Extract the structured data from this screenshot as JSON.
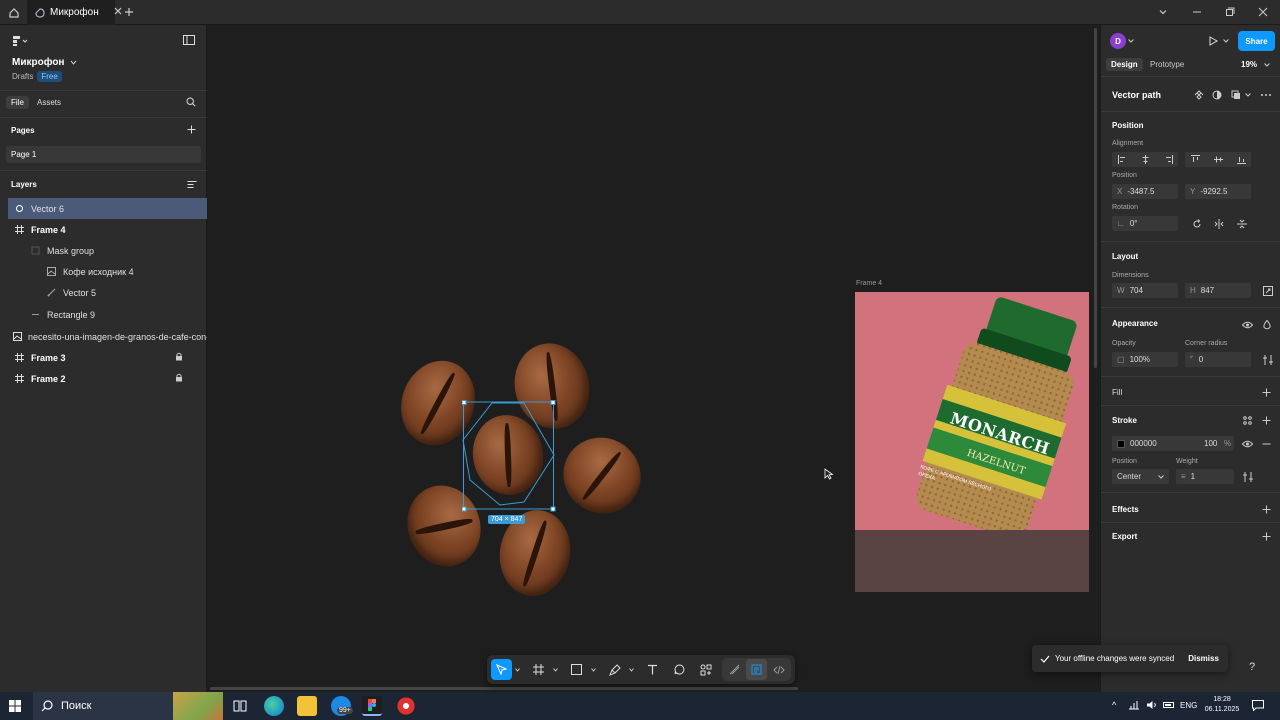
{
  "titlebar": {
    "tab_title": "Микрофон"
  },
  "left": {
    "file_name": "Микрофон",
    "drafts": "Drafts",
    "plan": "Free",
    "tabs": [
      "File",
      "Assets"
    ],
    "pages_title": "Pages",
    "page": "Page 1",
    "layers_title": "Layers",
    "layers": [
      {
        "name": "Vector 6"
      },
      {
        "name": "Frame 4"
      },
      {
        "name": "Mask group"
      },
      {
        "name": "Кофе исходник 4"
      },
      {
        "name": "Vector 5"
      },
      {
        "name": "Rectangle 9"
      },
      {
        "name": "necesito-una-imagen-de-granos-de-cafe-con-fond"
      },
      {
        "name": "Frame 3"
      },
      {
        "name": "Frame 2"
      }
    ]
  },
  "canvas": {
    "frame_label": "Frame 4",
    "size_badge": "704 × 847",
    "product_brand": "MONARCH",
    "product_flavor": "HAZELNUT",
    "product_sub": "КОФЕ С АРОМАТОМ ЛЕСНОГО ОРЕХА",
    "colors": {
      "frame_bg": "#d2727c",
      "frame_bottom": "#5a4343",
      "selection": "#3a9bd5"
    }
  },
  "right": {
    "avatar": "D",
    "share": "Share",
    "tabs": [
      "Design",
      "Prototype"
    ],
    "zoom": "19%",
    "selection_title": "Vector path",
    "position_title": "Position",
    "alignment_label": "Alignment",
    "position_label": "Position",
    "x_label": "X",
    "x_value": "-3487.5",
    "y_label": "Y",
    "y_value": "-9292.5",
    "rotation_label": "Rotation",
    "rotation_value": "0°",
    "layout_title": "Layout",
    "dimensions_label": "Dimensions",
    "w_label": "W",
    "w_value": "704",
    "h_label": "H",
    "h_value": "847",
    "appearance_title": "Appearance",
    "opacity_label": "Opacity",
    "opacity_value": "100%",
    "radius_label": "Corner radius",
    "radius_value": "0",
    "fill_title": "Fill",
    "stroke_title": "Stroke",
    "stroke_color": "000000",
    "stroke_opacity": "100",
    "stroke_pct": "%",
    "stroke_position_label": "Position",
    "stroke_weight_label": "Weight",
    "stroke_position": "Center",
    "stroke_weight": "1",
    "effects_title": "Effects",
    "export_title": "Export"
  },
  "toast": {
    "message": "Your offline changes were synced",
    "dismiss": "Dismiss"
  },
  "taskbar": {
    "search": "Поиск",
    "lang": "ENG",
    "time": "18:28",
    "date": "06.11.2025",
    "badge": "99+"
  }
}
